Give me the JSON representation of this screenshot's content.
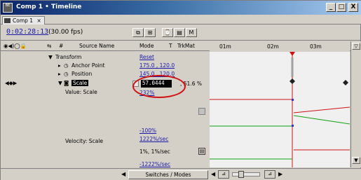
{
  "window": {
    "title": "Comp 1 • Timeline",
    "app_icon_text": "BE",
    "min_label": "_",
    "max_label": "□",
    "close_label": "X"
  },
  "tab": {
    "label": "Comp 1",
    "close_label": "×"
  },
  "timebar": {
    "timecode": "0:02:28:13",
    "fps": "(30.00 fps)",
    "buttons": [
      "⧉",
      "⊞",
      "⌚",
      "▤",
      "M"
    ]
  },
  "header": {
    "icons": "◉◀)◯🔒",
    "num_icon": "⇆",
    "hash": "#",
    "source_name": "Source Name",
    "mode": "Mode",
    "t": "T",
    "trkmat": "TrkMat",
    "ruler": [
      "01m",
      "02m",
      "03m"
    ]
  },
  "layers": {
    "transform": "Transform",
    "transform_value": "Reset",
    "anchor_point": "Anchor Point",
    "anchor_value": "175.0 , 120.0",
    "position": "Position",
    "position_value": "145.0 , 120.0",
    "scale": "Scale",
    "scale_input": "57.0444",
    "scale_second": ", 51.6 %",
    "value_scale": "Value: Scale",
    "value_scale_value": "232%",
    "min_pct": "-100%",
    "velocity_scale": "Velocity: Scale",
    "velocity_value": "1222%/sec",
    "vel_row2": "1%, 1%/sec",
    "vel_row3": "-1222%/sec"
  },
  "bottombar": {
    "switches_modes": "Switches / Modes"
  }
}
